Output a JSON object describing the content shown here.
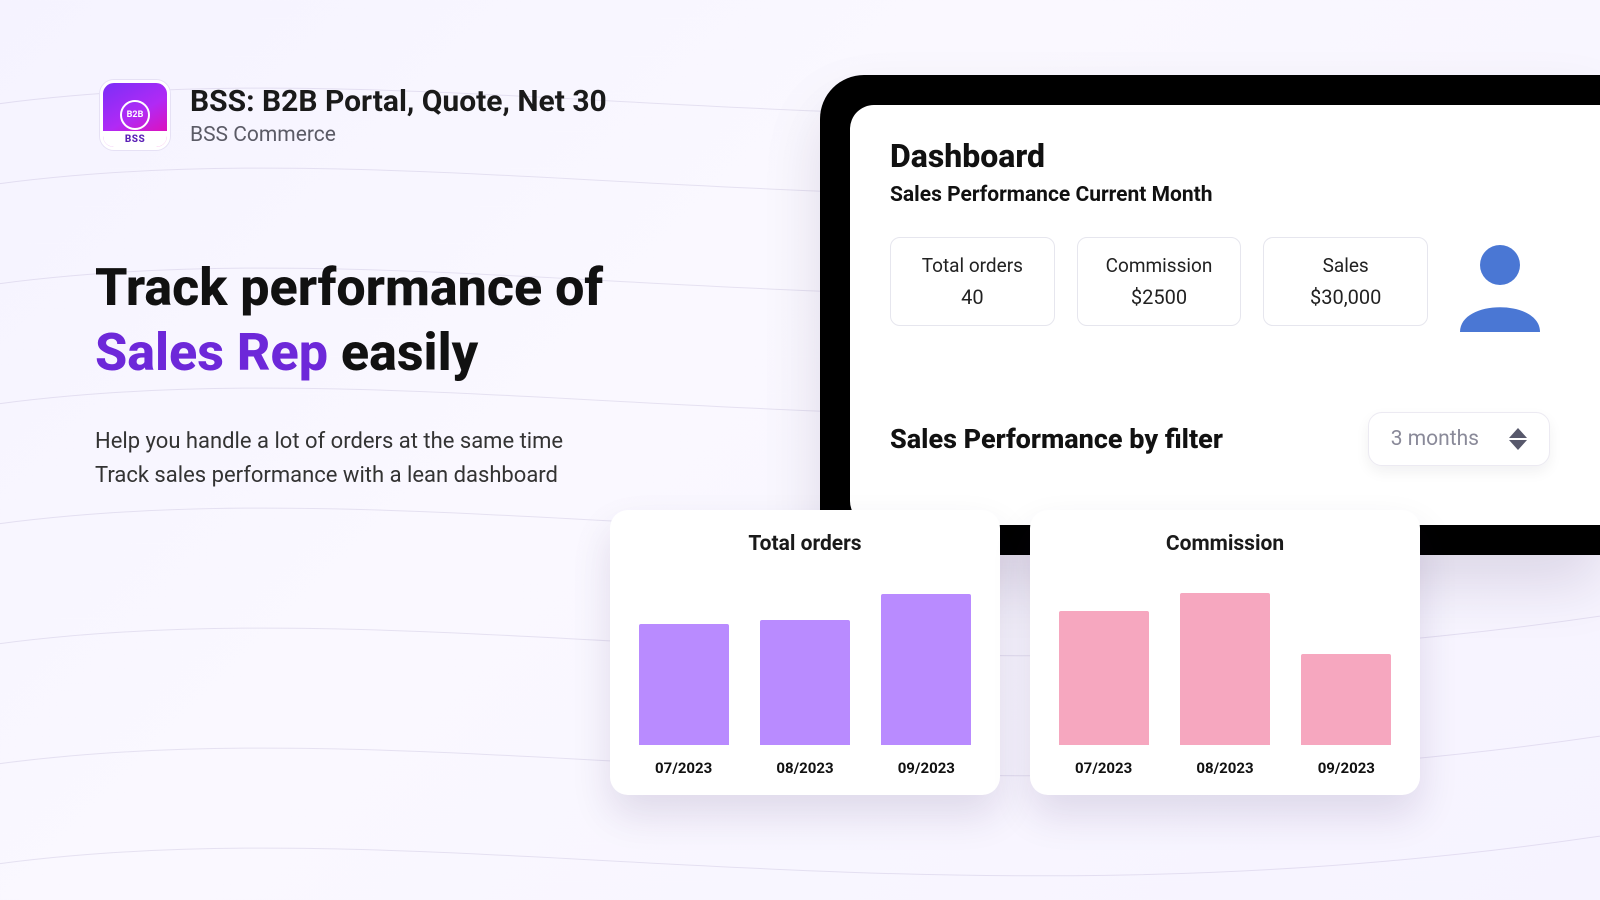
{
  "brand": {
    "title": "BSS: B2B Portal, Quote, Net 30",
    "subtitle": "BSS Commerce",
    "logo_badge": "BSS",
    "logo_mark": "B2B"
  },
  "hero": {
    "line1": "Track performance of",
    "accent": "Sales Rep",
    "line2_tail": " easily",
    "desc_line1": "Help you handle a lot of orders at the same time",
    "desc_line2": "Track sales performance with a lean dashboard"
  },
  "dashboard": {
    "title": "Dashboard",
    "subtitle": "Sales Performance Current Month",
    "stats": [
      {
        "label": "Total orders",
        "value": "40"
      },
      {
        "label": "Commission",
        "value": "$2500"
      },
      {
        "label": "Sales",
        "value": "$30,000"
      }
    ],
    "filter_heading": "Sales Performance by filter",
    "filter_value": "3 months"
  },
  "chart_data": [
    {
      "type": "bar",
      "title": "Total orders",
      "categories": [
        "07/2023",
        "08/2023",
        "09/2023"
      ],
      "values": [
        32,
        33,
        40
      ],
      "ylim": [
        0,
        45
      ],
      "color": "#b98bff"
    },
    {
      "type": "bar",
      "title": "Commission",
      "categories": [
        "07/2023",
        "08/2023",
        "09/2023"
      ],
      "values": [
        2200,
        2500,
        1500
      ],
      "ylim": [
        0,
        2800
      ],
      "color": "#f6a7bf"
    }
  ]
}
